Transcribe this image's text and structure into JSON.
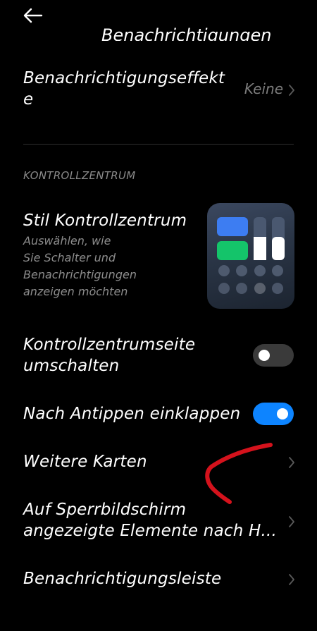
{
  "header": {
    "back_icon": "arrow-left-icon",
    "scrolled_title": "Benachrichtigungen"
  },
  "items": {
    "notification_effects": {
      "label_line1": "Benachrichtigungseffekt",
      "label_line2": "e",
      "value": "Keine"
    },
    "section_header": "KONTROLLZENTRUM",
    "control_center_style": {
      "title": "Stil Kontrollzentrum",
      "desc_line1": "Auswählen, wie",
      "desc_line2": "Sie Schalter und",
      "desc_line3": "Benachrichtigungen",
      "desc_line4": "anzeigen möchten"
    },
    "switch_page": {
      "label_line1": "Kontrollzentrumseite",
      "label_line2": "umschalten",
      "enabled": false
    },
    "collapse_on_tap": {
      "label": "Nach Antippen einklappen",
      "enabled": true
    },
    "more_cards": {
      "label": "Weitere Karten"
    },
    "lockscreen_items": {
      "label_line1": "Auf Sperrbildschirm",
      "label_line2": "angezeigte Elemente nach H..."
    },
    "notification_bar": {
      "label": "Benachrichtigungsleiste"
    }
  },
  "colors": {
    "background": "#000000",
    "accent_blue": "#0d84ff",
    "toggle_off": "#3a3a3a",
    "annotation_red": "#d4121c",
    "tile_blue": "#3d7df2",
    "tile_green": "#14c46a"
  }
}
